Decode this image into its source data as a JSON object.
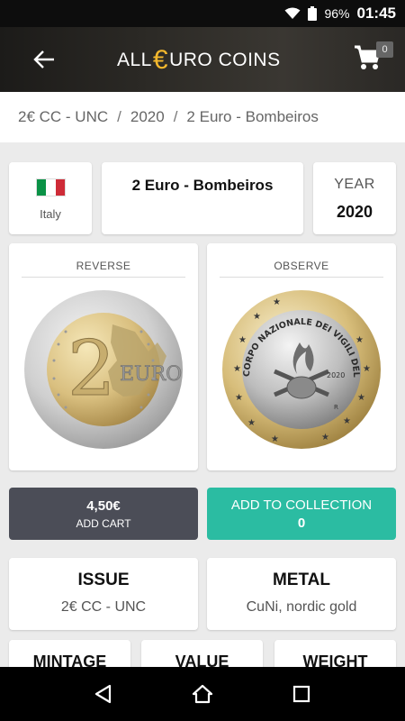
{
  "status_bar": {
    "battery": "96%",
    "time": "01:45"
  },
  "app_bar": {
    "brand_left": "ALL",
    "brand_symbol": "€",
    "brand_right": "URO COINS",
    "cart_count": "0",
    "accent_color": "#f4b82d"
  },
  "breadcrumb": {
    "items": [
      "2€ CC - UNC",
      "2020",
      "2 Euro - Bombeiros"
    ],
    "separator": "/"
  },
  "coin": {
    "country": "Italy",
    "title": "2 Euro - Bombeiros",
    "year_label": "YEAR",
    "year": "2020",
    "reverse_label": "REVERSE",
    "observe_label": "OBSERVE",
    "reverse_numeral": "2",
    "reverse_text": "EURO",
    "observe_inscription": "CORPO NAZIONALE DEI VIGILI DEL FUOCO",
    "observe_year": "2020",
    "observe_mint": "R"
  },
  "actions": {
    "price": "4,50€",
    "add_cart": "ADD CART",
    "add_collection": "ADD TO COLLECTION",
    "collection_count": "0",
    "price_button_color": "#4b4d57",
    "collection_button_color": "#2bbca2"
  },
  "details": {
    "issue_label": "ISSUE",
    "issue_value": "2€ CC - UNC",
    "metal_label": "METAL",
    "metal_value": "CuNi, nordic gold",
    "mintage_label": "MINTAGE",
    "value_label": "VALUE",
    "weight_label": "WEIGHT"
  },
  "icons": {
    "back": "arrow-left-icon",
    "cart": "cart-icon",
    "wifi": "wifi-icon",
    "battery": "battery-icon",
    "nav_back": "triangle-back-icon",
    "nav_home": "home-icon",
    "nav_recent": "square-recent-icon"
  }
}
